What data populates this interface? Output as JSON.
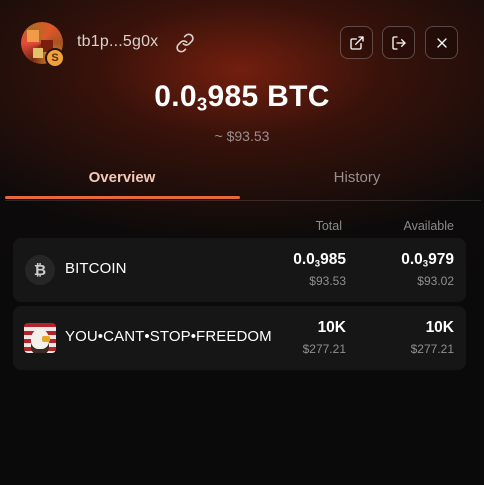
{
  "header": {
    "address": "tb1p...5g0x",
    "chain_badge": "S",
    "icons": {
      "link": "link-icon",
      "external": "external-link-icon",
      "logout": "logout-icon",
      "close": "close-icon"
    }
  },
  "balance": {
    "prefix": "0.0",
    "zeros": "3",
    "digits": "985",
    "unit": "BTC",
    "fiat": "~ $93.53"
  },
  "tabs": [
    {
      "label": "Overview",
      "active": true
    },
    {
      "label": "History",
      "active": false
    }
  ],
  "table": {
    "columns": {
      "total": "Total",
      "available": "Available"
    },
    "rows": [
      {
        "icon": "bitcoin-icon",
        "icon_glyph": "₿",
        "name": "BITCOIN",
        "total_prefix": "0.0",
        "total_zeros": "3",
        "total_digits": "985",
        "total_fiat": "$93.53",
        "avail_prefix": "0.0",
        "avail_zeros": "3",
        "avail_digits": "979",
        "avail_fiat": "$93.02"
      },
      {
        "icon": "eagle-icon",
        "name": "YOU•CANT•STOP•FREEDOM",
        "total": "10K",
        "total_fiat": "$277.21",
        "avail": "10K",
        "avail_fiat": "$277.21"
      }
    ]
  },
  "colors": {
    "accent": "#e8673d",
    "active_tab_text": "#f3c8b6",
    "background": "#0b0b0b",
    "row_background": "#161616"
  }
}
